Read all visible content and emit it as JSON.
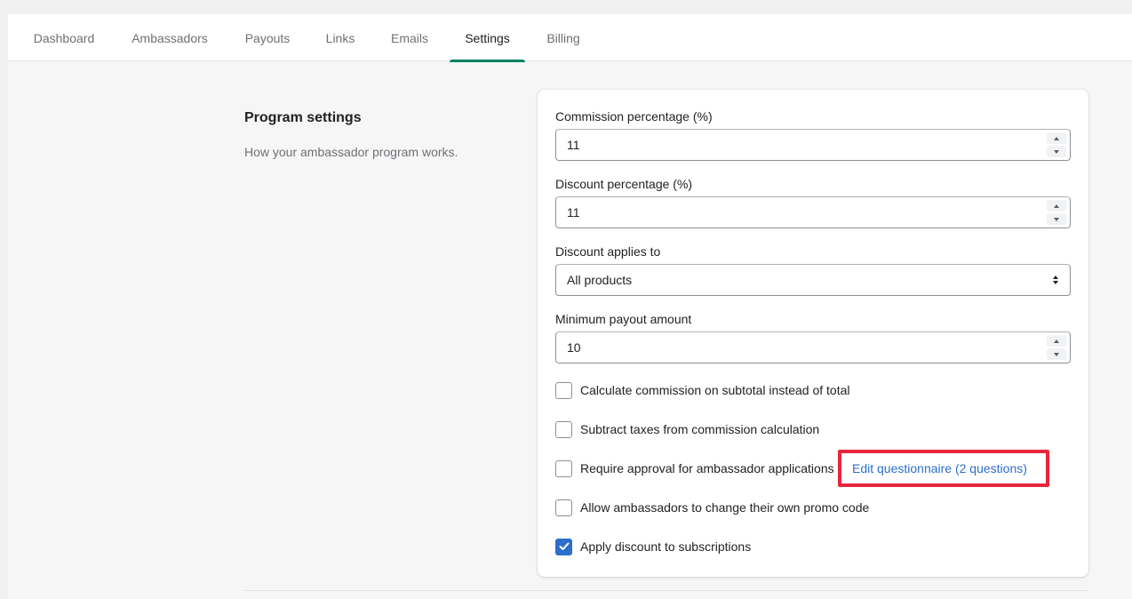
{
  "tabs": [
    {
      "label": "Dashboard"
    },
    {
      "label": "Ambassadors"
    },
    {
      "label": "Payouts"
    },
    {
      "label": "Links"
    },
    {
      "label": "Emails"
    },
    {
      "label": "Settings",
      "active": true
    },
    {
      "label": "Billing"
    }
  ],
  "section": {
    "title": "Program settings",
    "description": "How your ambassador program works."
  },
  "fields": {
    "commission": {
      "label": "Commission percentage (%)",
      "value": "11"
    },
    "discount": {
      "label": "Discount percentage (%)",
      "value": "11"
    },
    "applies_to": {
      "label": "Discount applies to",
      "value": "All products"
    },
    "min_payout": {
      "label": "Minimum payout amount",
      "value": "10"
    }
  },
  "checkboxes": [
    {
      "label": "Calculate commission on subtotal instead of total",
      "checked": false
    },
    {
      "label": "Subtract taxes from commission calculation",
      "checked": false
    },
    {
      "label": "Require approval for ambassador applications",
      "checked": false
    },
    {
      "label": "Allow ambassadors to change their own promo code",
      "checked": false
    },
    {
      "label": "Apply discount to subscriptions",
      "checked": true
    }
  ],
  "questionnaire_link": "Edit questionnaire (2 questions)",
  "icons": {
    "spinner_up": "chevron-up-icon",
    "spinner_down": "chevron-down-icon",
    "select": "select-arrows-icon",
    "check": "checkmark-icon"
  },
  "colors": {
    "accent": "#008060",
    "link": "#2c6ecb",
    "checkbox_checked": "#2c6ecb",
    "highlight": "#e8263d"
  }
}
